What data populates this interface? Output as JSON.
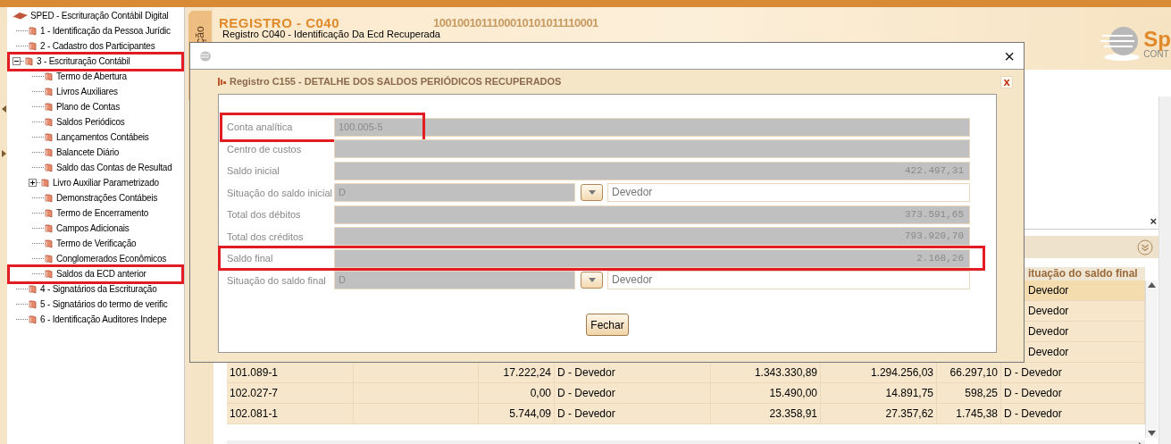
{
  "tree": {
    "label": "SPED - Escrituração Contábil Digital",
    "children": [
      {
        "label": "1 - Identificação da Pessoa Jurídic"
      },
      {
        "label": "2 - Cadastro dos Participantes"
      },
      {
        "label": "3 - Escrituração Contábil",
        "expanded": true,
        "highlighted": true,
        "children": [
          {
            "label": "Termo de Abertura"
          },
          {
            "label": "Livros Auxiliares"
          },
          {
            "label": "Plano de Contas"
          },
          {
            "label": "Saldos Periódicos"
          },
          {
            "label": "Lançamentos Contábeis"
          },
          {
            "label": "Balancete Diário"
          },
          {
            "label": "Saldo das Contas de Resultad"
          },
          {
            "label": "Livro Auxiliar Parametrizado",
            "expanded": false
          },
          {
            "label": "Demonstrações Contábeis"
          },
          {
            "label": "Termo de Encerramento"
          },
          {
            "label": "Campos Adicionais"
          },
          {
            "label": "Termo de Verificação"
          },
          {
            "label": "Conglomerados Econômicos"
          },
          {
            "label": "Saldos da ECD anterior",
            "highlighted": true
          }
        ]
      },
      {
        "label": "4 - Signatários da Escrituração"
      },
      {
        "label": "5 - Signatários do termo de verific"
      },
      {
        "label": "6 - Identificação Auditores Indepe"
      }
    ]
  },
  "side_tab": "ção",
  "header": {
    "title": "REGISTRO - C040",
    "subtitle": "Registro C040 - Identificação Da Ecd Recuperada",
    "pattern": "1001001011100010101011110001",
    "logo": "Sp",
    "logo_sub": "CONT"
  },
  "panel": {
    "close": "×"
  },
  "table": {
    "last_column_header": "ituação do saldo final",
    "rows": [
      {
        "selected": true,
        "c8": "Devedor"
      },
      {
        "selected": false,
        "c8": "Devedor"
      },
      {
        "selected": false,
        "c8": "Devedor"
      },
      {
        "selected": false,
        "c8": "Devedor"
      },
      {
        "selected": false,
        "c1": "101.089-1",
        "c3": "17.222,24",
        "c4": "D - Devedor",
        "c5": "1.343.330,89",
        "c6": "1.294.256,03",
        "c7": "66.297,10",
        "c8": "D - Devedor"
      },
      {
        "selected": false,
        "c1": "102.027-7",
        "c3": "0,00",
        "c4": "D - Devedor",
        "c5": "15.490,00",
        "c6": "14.891,75",
        "c7": "598,25",
        "c8": "D - Devedor"
      },
      {
        "selected": false,
        "c1": "102.081-1",
        "c3": "5.744,09",
        "c4": "D - Devedor",
        "c5": "23.358,91",
        "c6": "27.357,62",
        "c7": "1.745,38",
        "c8": "D - Devedor"
      }
    ]
  },
  "dialog": {
    "close": "×",
    "title": "Registro C155 - DETALHE DOS SALDOS PERIÓDICOS RECUPERADOS",
    "inner_close": "x",
    "fields": [
      {
        "kind": "text",
        "label": "Conta analítica",
        "value": "100.005-5",
        "highlighted": true
      },
      {
        "kind": "text",
        "label": "Centro de custos"
      },
      {
        "kind": "amount",
        "label": "Saldo inicial",
        "value": "422.497,31"
      },
      {
        "kind": "select",
        "label": "Situação do saldo inicial",
        "value": "D",
        "description": "Devedor"
      },
      {
        "kind": "amount",
        "label": "Total dos débitos",
        "value": "373.591,65"
      },
      {
        "kind": "amount",
        "label": "Total dos créditos",
        "value": "793.920,70"
      },
      {
        "kind": "amount",
        "label": "Saldo final",
        "value": "2.168,26",
        "highlighted": true
      },
      {
        "kind": "select",
        "label": "Situação do saldo final",
        "value": "D",
        "description": "Devedor"
      }
    ],
    "button": "Fechar"
  }
}
